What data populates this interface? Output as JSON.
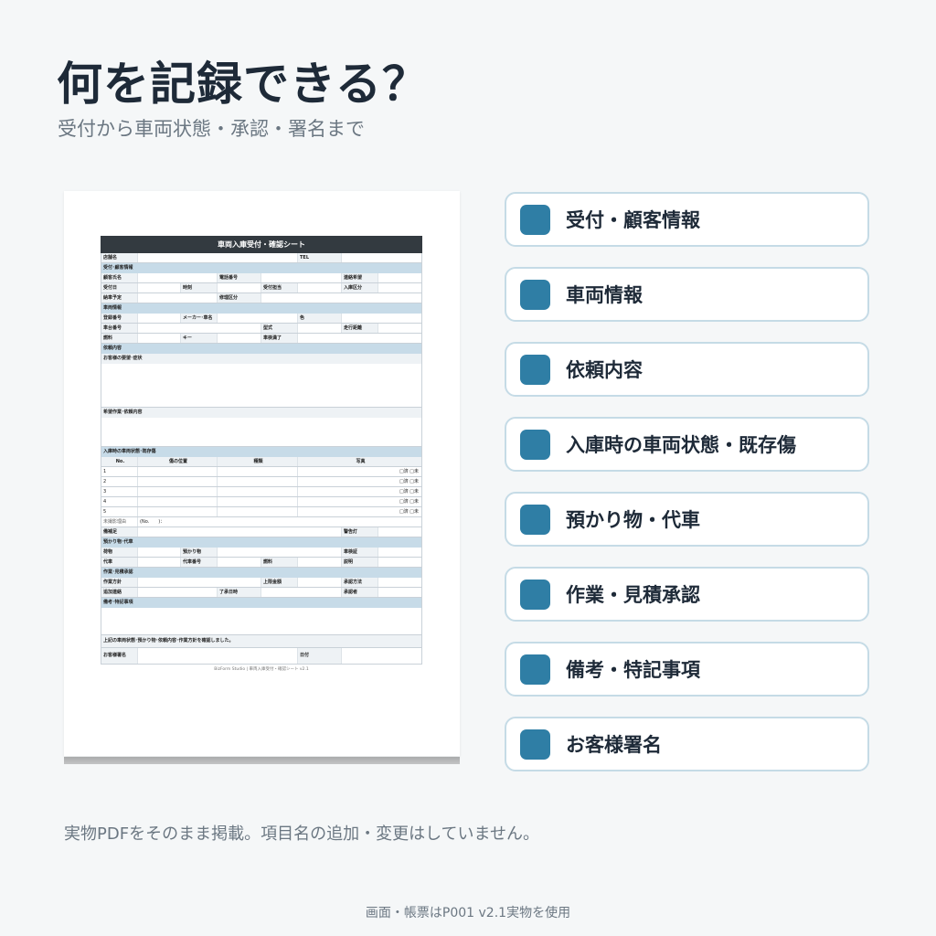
{
  "header": {
    "title": "何を記録できる？",
    "subtitle": "受付から車両状態・承認・署名まで"
  },
  "form": {
    "title": "車両入庫受付・確認シート",
    "store_label": "店舗名",
    "tel_label": "TEL",
    "sec_customer": "受付･顧客情報",
    "customer_name": "顧客氏名",
    "phone": "電話番号",
    "contact_pref": "連絡希望",
    "reception_date": "受付日",
    "time": "時刻",
    "staff": "受付担当",
    "entry_type": "入庫区分",
    "delivery_plan": "納車予定",
    "repair_type": "修理区分",
    "sec_vehicle": "車両情報",
    "reg_no": "登録番号",
    "maker": "メーカー･車名",
    "color": "色",
    "chassis": "車台番号",
    "model": "型式",
    "mileage": "走行距離",
    "fuel": "燃料",
    "key": "キー",
    "inspection": "車検満了",
    "sec_request": "依頼内容",
    "symptoms": "お客様の要望･症状",
    "work_request": "希望作業･依頼内容",
    "sec_condition": "入庫時の車両状態･既存傷",
    "col_no": "No.",
    "col_pos": "傷の位置",
    "col_type": "種類",
    "col_photo": "写真",
    "rows": [
      "1",
      "2",
      "3",
      "4",
      "5"
    ],
    "check": "□済 □未",
    "unshot_reason": "未撮影理由",
    "no_ref": "(No.　　)：",
    "equipment": "備補足",
    "warning_light": "警告灯",
    "sec_deposit": "預かり物･代車",
    "luggage": "荷物",
    "deposit_items": "預かり物",
    "inspection_cert": "車検証",
    "loaner": "代車",
    "loaner_no": "代車番号",
    "fuel2": "燃料",
    "explain": "説明",
    "sec_work": "作業･見積承認",
    "work_policy": "作業方針",
    "limit": "上限金額",
    "approval_method": "承認方法",
    "extra_contact": "追加連絡",
    "approval_time": "了承日時",
    "approver": "承認者",
    "sec_notes": "備考･特記事項",
    "confirm_text": "上記の車両状態･預かり物･依頼内容･作業方針を確認しました。",
    "signature": "お客様署名",
    "date": "日付",
    "footer": "BizForm Studio | 車両入庫受付・確認シート v2.1"
  },
  "cards": [
    {
      "label": "受付・顧客情報"
    },
    {
      "label": "車両情報"
    },
    {
      "label": "依頼内容"
    },
    {
      "label": "入庫時の車両状態・既存傷"
    },
    {
      "label": "預かり物・代車"
    },
    {
      "label": "作業・見積承認"
    },
    {
      "label": "備考・特記事項"
    },
    {
      "label": "お客様署名"
    }
  ],
  "note": "実物PDFをそのまま掲載。項目名の追加・変更はしていません。",
  "credit": "画面・帳票はP001 v2.1実物を使用",
  "colors": {
    "accent": "#2f7ea5",
    "card_border": "#c5dbe6",
    "section_fill": "#c7dbe8",
    "sheet_header": "#333a40",
    "title_text": "#1e2a38"
  }
}
